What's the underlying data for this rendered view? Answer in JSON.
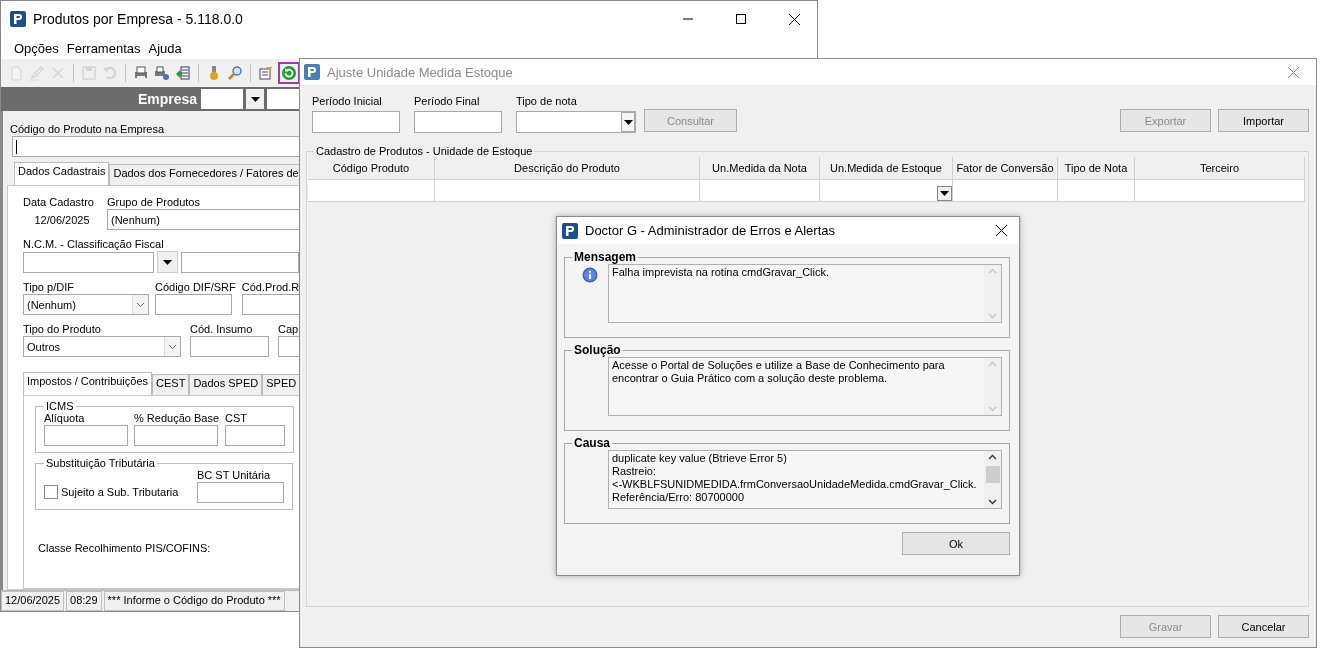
{
  "main_window": {
    "title": "Produtos por Empresa - 5.118.0.0",
    "menu": [
      "Opções",
      "Ferramentas",
      "Ajuda"
    ],
    "toolbar": [
      [
        {
          "kind": "new",
          "disabled": true,
          "highlighted": false
        },
        {
          "kind": "edit",
          "disabled": true,
          "highlighted": false
        },
        {
          "kind": "delete",
          "disabled": true,
          "highlighted": false
        }
      ],
      [
        {
          "kind": "save",
          "disabled": true,
          "highlighted": false
        },
        {
          "kind": "undo",
          "disabled": true,
          "highlighted": false
        }
      ],
      [
        {
          "kind": "print",
          "disabled": false,
          "highlighted": false
        },
        {
          "kind": "print_setup",
          "disabled": false,
          "highlighted": false
        },
        {
          "kind": "export",
          "disabled": false,
          "highlighted": false
        }
      ],
      [
        {
          "kind": "tool",
          "disabled": false,
          "highlighted": false
        },
        {
          "kind": "search",
          "disabled": false,
          "highlighted": false
        }
      ],
      [
        {
          "kind": "properties",
          "disabled": false,
          "highlighted": false
        },
        {
          "kind": "refresh",
          "disabled": false,
          "highlighted": true
        }
      ]
    ],
    "empresa_label": "Empresa",
    "product_code_label": "Código do Produto na Empresa",
    "tabs": [
      {
        "label": "Dados Cadastrais",
        "selected": true
      },
      {
        "label": "Dados dos Fornecedores / Fatores de",
        "selected": false
      }
    ],
    "data_cadastro": {
      "label": "Data Cadastro",
      "value": "12/06/2025"
    },
    "grupo_produtos": {
      "label": "Grupo de Produtos",
      "value": "(Nenhum)"
    },
    "ncm": {
      "label": "N.C.M. -  Classificação Fiscal"
    },
    "tipo_dif": {
      "label": "Tipo p/DIF",
      "value": "(Nenhum)"
    },
    "codigo_dif": {
      "label": "Código DIF/SRF"
    },
    "cod_prod": {
      "label": "Cód.Prod.R"
    },
    "tipo_produto": {
      "label": "Tipo do Produto",
      "value": "Outros"
    },
    "cod_insumo": {
      "label": "Cód. Insumo"
    },
    "cap": {
      "label": "Cap"
    },
    "sub_tabs": [
      {
        "label": "Impostos / Contribuições",
        "selected": true
      },
      {
        "label": "CEST",
        "selected": false
      },
      {
        "label": "Dados SPED",
        "selected": false
      },
      {
        "label": "SPED",
        "selected": false
      }
    ],
    "icms": {
      "title": "ICMS",
      "fields": [
        "Alíquota",
        "% Redução Base",
        "CST"
      ]
    },
    "st": {
      "title": "Substituição Tributária",
      "checkbox": {
        "label": "Sujeito a Sub. Tributaria",
        "checked": false
      },
      "field": "BC ST Unitária"
    },
    "pis_label": "Classe Recolhimento PIS/COFINS:",
    "status_bar": [
      "12/06/2025",
      "08:29",
      "*** Informe o Código do Produto ***"
    ]
  },
  "adjust_window": {
    "title": "Ajuste Unidade Medida Estoque",
    "filters": [
      {
        "label": "Período Inicial",
        "kind": "text"
      },
      {
        "label": "Período Final",
        "kind": "text"
      },
      {
        "label": "Tipo de nota",
        "kind": "combo"
      }
    ],
    "consultar": {
      "label": "Consultar",
      "disabled": true
    },
    "actions": [
      {
        "label": "Exportar",
        "disabled": true
      },
      {
        "label": "Importar",
        "disabled": false
      }
    ],
    "group_title": "Cadastro de Produtos - Unidade de Estoque",
    "columns": [
      {
        "label": "Código Produto",
        "kind": "text"
      },
      {
        "label": "Descrição do Produto",
        "kind": "text"
      },
      {
        "label": "Un.Medida da Nota",
        "kind": "text"
      },
      {
        "label": "Un.Medida de Estoque",
        "kind": "combo"
      },
      {
        "label": "Fator de Conversão",
        "kind": "text"
      },
      {
        "label": "Tipo de Nota",
        "kind": "text"
      },
      {
        "label": "Terceiro",
        "kind": "text"
      }
    ],
    "bottom_buttons": [
      {
        "label": "Gravar",
        "disabled": true
      },
      {
        "label": "Cancelar",
        "disabled": false
      }
    ]
  },
  "dialog": {
    "title": "Doctor G - Administrador de Erros e Alertas",
    "sections": [
      {
        "title": "Mensagem",
        "kind": "info",
        "text": "Falha imprevista na rotina cmdGravar_Click.",
        "scrollable": false
      },
      {
        "title": "Solução",
        "kind": "plain",
        "text": "Acesse o Portal de Soluções e utilize a Base de Conhecimento para encontrar o Guia Prático com a solução deste problema.",
        "scrollable": false
      },
      {
        "title": "Causa",
        "kind": "plain",
        "text": "duplicate key value (Btrieve Error 5)\nRastreio:\n<-WKBLFSUNIDMEDIDA.frmConversaoUnidadeMedida.cmdGravar_Click.\nReferência/Erro: 80700000",
        "scrollable": true
      }
    ],
    "ok": "Ok"
  }
}
